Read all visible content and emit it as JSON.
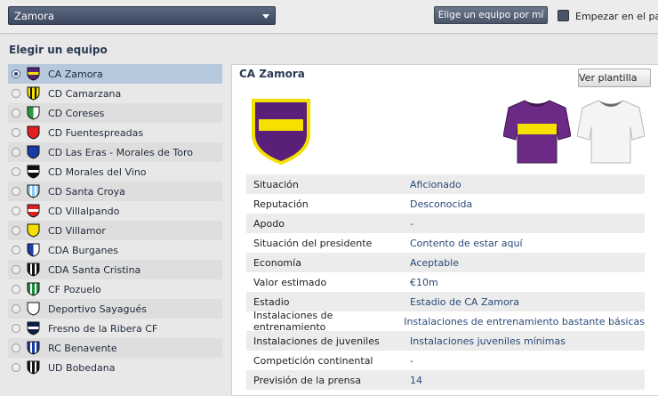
{
  "topbar": {
    "selected_team": "Zamora",
    "random_button": "Elige un equipo por mí",
    "start_paused_label": "Empezar en el paro"
  },
  "section_title": "Elegir un equipo",
  "teams": [
    {
      "name": "CA Zamora",
      "selected": true
    },
    {
      "name": "CD Camarzana",
      "selected": false
    },
    {
      "name": "CD Coreses",
      "selected": false
    },
    {
      "name": "CD Fuentespreadas",
      "selected": false
    },
    {
      "name": "CD Las Eras - Morales de Toro",
      "selected": false
    },
    {
      "name": "CD Morales del Vino",
      "selected": false
    },
    {
      "name": "CD Santa Croya",
      "selected": false
    },
    {
      "name": "CD Villalpando",
      "selected": false
    },
    {
      "name": "CD Villamor",
      "selected": false
    },
    {
      "name": "CDA Burganes",
      "selected": false
    },
    {
      "name": "CDA Santa Cristina",
      "selected": false
    },
    {
      "name": "CF Pozuelo",
      "selected": false
    },
    {
      "name": "Deportivo Sayagués",
      "selected": false
    },
    {
      "name": "Fresno de la Ribera CF",
      "selected": false
    },
    {
      "name": "RC Benavente",
      "selected": false
    },
    {
      "name": "UD Bobedana",
      "selected": false
    }
  ],
  "detail": {
    "title": "CA Zamora",
    "squad_button": "Ver plantilla",
    "info": [
      {
        "key": "Situación",
        "value": "Aficionado"
      },
      {
        "key": "Reputación",
        "value": "Desconocida"
      },
      {
        "key": "Apodo",
        "value": "-"
      },
      {
        "key": "Situación del presidente",
        "value": "Contento de estar aquí"
      },
      {
        "key": "Economía",
        "value": "Aceptable"
      },
      {
        "key": "Valor estimado",
        "value": "€10m"
      },
      {
        "key": "Estadio",
        "value": "Estadio de CA Zamora"
      },
      {
        "key": "Instalaciones de entrenamiento",
        "value": "Instalaciones de entrenamiento bastante básicas"
      },
      {
        "key": "Instalaciones de juveniles",
        "value": "Instalaciones juveniles mínimas"
      },
      {
        "key": "Competición continental",
        "value": "-"
      },
      {
        "key": "Previsión de la prensa",
        "value": "14"
      }
    ]
  },
  "colors": {
    "home_kit_primary": "#6a2a86",
    "home_kit_band": "#f5e000",
    "away_kit": "#f4f4f4"
  }
}
